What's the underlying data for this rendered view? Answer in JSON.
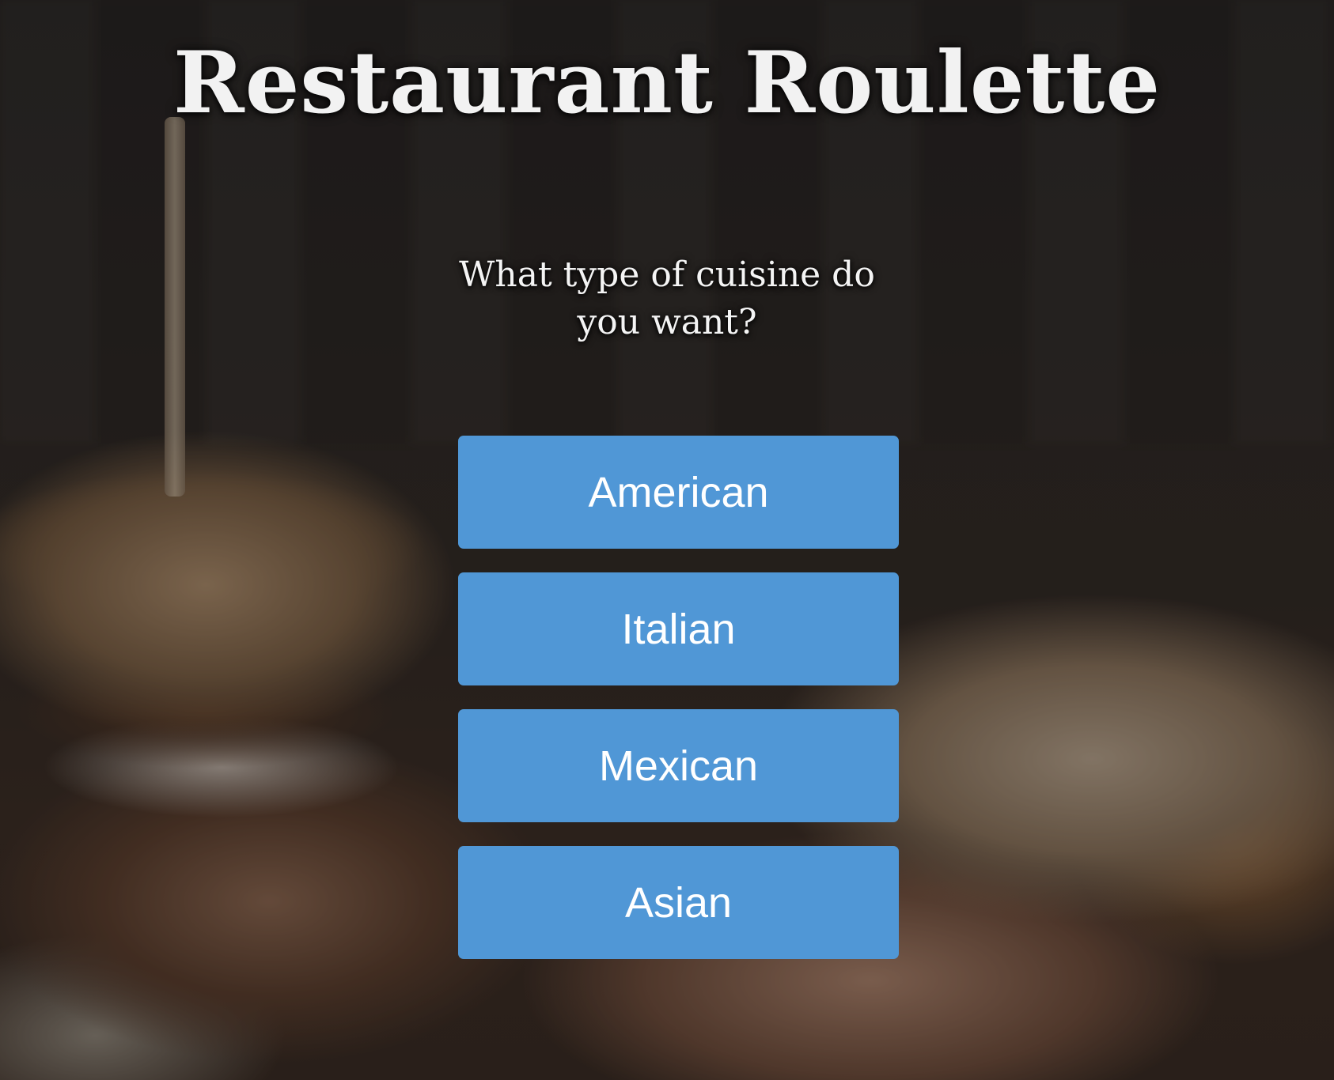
{
  "header": {
    "title": "Restaurant Roulette"
  },
  "prompt": {
    "question": "What type of cuisine do you want?"
  },
  "cuisine_options": [
    {
      "label": "American"
    },
    {
      "label": "Italian"
    },
    {
      "label": "Mexican"
    },
    {
      "label": "Asian"
    }
  ],
  "colors": {
    "button_background": "#5097d6",
    "button_text": "#ffffff",
    "title_text": "#f2f2f2"
  },
  "background": {
    "image": "food-photo-burger-and-tacos"
  }
}
